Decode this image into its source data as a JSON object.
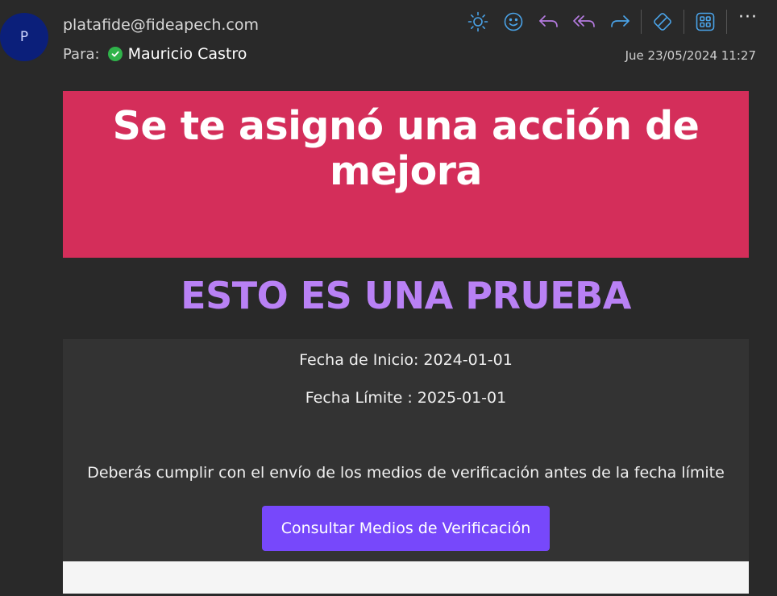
{
  "header": {
    "avatar_letter": "P",
    "sender": "platafide@fideapech.com",
    "to_label": "Para:",
    "recipient": "Mauricio Castro",
    "date": "Jue 23/05/2024 11:27"
  },
  "toolbar": {
    "icons": [
      "brightness-icon",
      "emoji-icon",
      "reply-icon",
      "reply-all-icon",
      "forward-icon",
      "sticker-icon",
      "apps-icon",
      "more-icon"
    ],
    "more_label": "···"
  },
  "email": {
    "banner_title": "Se te asignó una acción de mejora",
    "test_heading": "ESTO ES UNA PRUEBA",
    "start_date": "Fecha de Inicio: 2024-01-01",
    "due_date": "Fecha Límite : 2025-01-01",
    "instruction": "Deberás cumplir con el envío de los medios de verificación antes de la fecha límite",
    "cta_label": "Consultar Medios de Verificación"
  },
  "colors": {
    "banner": "#d42e5a",
    "test_heading": "#b981f5",
    "cta": "#7748fb",
    "toolbar_blue": "#4aa3e8",
    "toolbar_purple": "#b57be0"
  }
}
